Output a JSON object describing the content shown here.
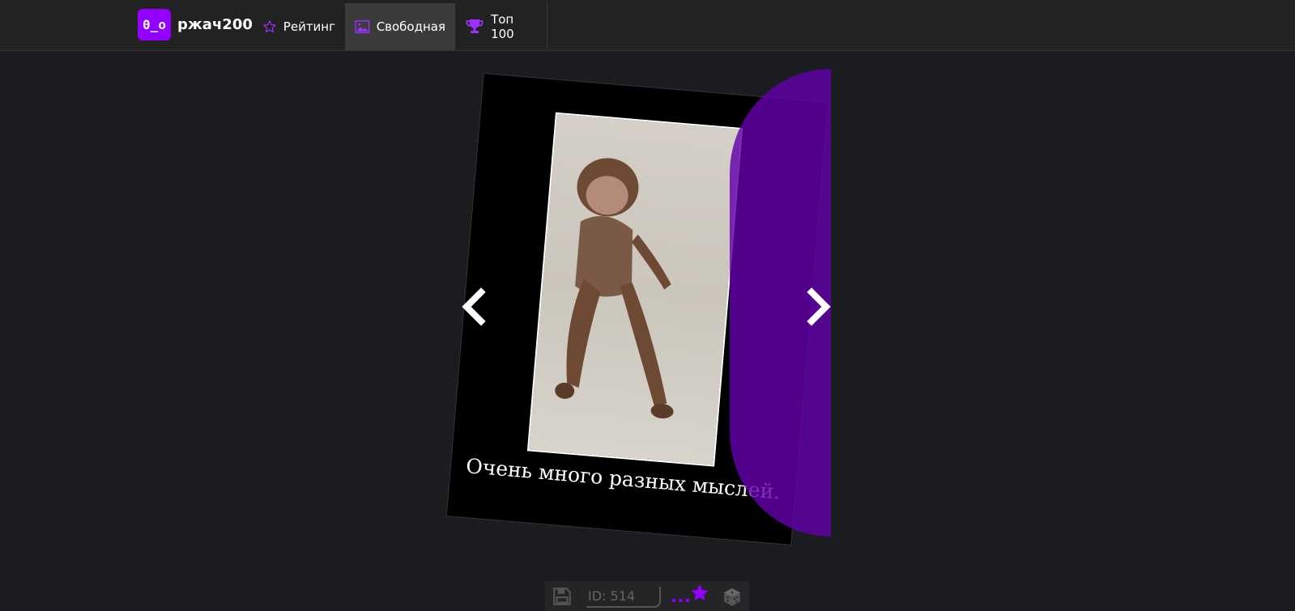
{
  "header": {
    "logo_text": "0_o",
    "site_name": "ржач200",
    "nav": [
      {
        "label": "Рейтинг",
        "icon": "star-outline-icon"
      },
      {
        "label": "Свободная",
        "icon": "image-icon",
        "active": true
      },
      {
        "label": "Топ 100",
        "icon": "trophy-icon"
      }
    ]
  },
  "card": {
    "caption": "Очень много разных мыслей."
  },
  "controls": {
    "prev_icon": "chevron-left-icon",
    "next_icon": "chevron-right-icon"
  },
  "bottom_bar": {
    "save_icon": "floppy-disk-icon",
    "id_text": "ID: 514",
    "favorite_dots": "...",
    "favorite_icon": "star-icon",
    "random_icon": "dice-icon"
  },
  "colors": {
    "accent": "#9400ff",
    "background": "#1b1c1f",
    "header": "#222222"
  }
}
